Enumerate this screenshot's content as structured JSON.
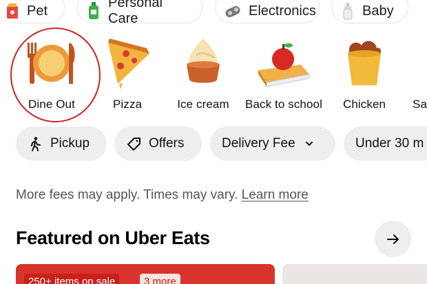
{
  "top_categories": [
    {
      "label": "Pet",
      "icon": "pet-food-icon"
    },
    {
      "label": "Personal Care",
      "icon": "personal-care-bottle-icon"
    },
    {
      "label": "Electronics",
      "icon": "electronics-icon"
    },
    {
      "label": "Baby",
      "icon": "baby-bottle-icon"
    }
  ],
  "food_categories": [
    {
      "label": "Dine Out",
      "icon": "dine-out-plate-icon",
      "selected": true
    },
    {
      "label": "Pizza",
      "icon": "pizza-slice-icon"
    },
    {
      "label": "Ice cream",
      "icon": "ice-cream-icon"
    },
    {
      "label": "Back to school",
      "icon": "apple-book-icon"
    },
    {
      "label": "Chicken",
      "icon": "chicken-bucket-icon"
    },
    {
      "label": "Sa",
      "icon": "partial-category-icon"
    }
  ],
  "filters": [
    {
      "label": "Pickup",
      "icon": "walking-person-icon"
    },
    {
      "label": "Offers",
      "icon": "tag-icon"
    },
    {
      "label": "Delivery Fee",
      "icon": "chevron-down-icon"
    },
    {
      "label": "Under 30 m"
    }
  ],
  "fee_note": {
    "text": "More fees may apply. Times may vary.",
    "link": "Learn more"
  },
  "featured": {
    "title": "Featured on Uber Eats",
    "cards": [
      {
        "badge": "250+ items on sale",
        "secondary_badge": "3 more"
      }
    ]
  },
  "colors": {
    "highlight_circle": "#d21f1f",
    "pill_bg": "#eeeeee",
    "sale_red": "#c8201a"
  }
}
